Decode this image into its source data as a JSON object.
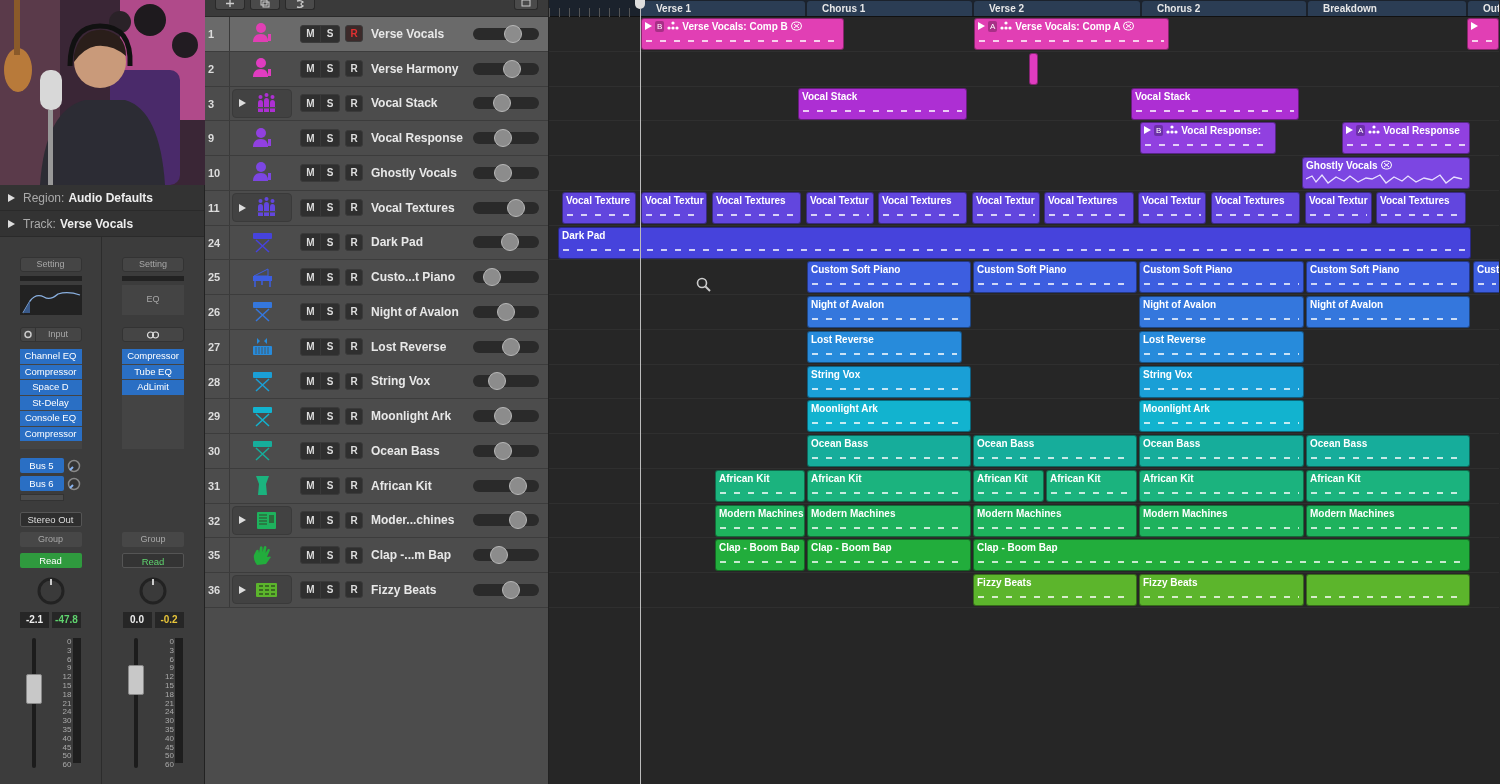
{
  "inspector": {
    "region": {
      "label": "Region:",
      "value": "Audio Defaults"
    },
    "track": {
      "label": "Track:",
      "value": "Verse Vocals"
    }
  },
  "channel_strips": [
    {
      "setting": "Setting",
      "eq": {
        "kind": "curve"
      },
      "input": {
        "kind": "input",
        "label": "Input"
      },
      "plugins": [
        "Channel EQ",
        "Compressor",
        "Space D",
        "St-Delay",
        "Console EQ",
        "Compressor"
      ],
      "sends": [
        "Bus 5",
        "Bus 6"
      ],
      "output": "Stereo Out",
      "group": "Group",
      "automation": {
        "label": "Read",
        "active": true
      },
      "readings": [
        {
          "text": "-2.1",
          "color": "#eeeeee"
        },
        {
          "text": "-47.8",
          "color": "#5fd36e"
        }
      ],
      "level": 0.64,
      "scale": [
        "0",
        "3",
        "6",
        "9",
        "12",
        "15",
        "18",
        "21",
        "24",
        "30",
        "35",
        "40",
        "45",
        "50",
        "60"
      ]
    },
    {
      "setting": "Setting",
      "eq": {
        "kind": "label",
        "label": "EQ"
      },
      "input": {
        "kind": "link"
      },
      "plugins": [
        "Compressor",
        "Tube EQ",
        "AdLimit"
      ],
      "group": "Group",
      "automation": {
        "label": "Read",
        "active": false
      },
      "readings": [
        {
          "text": "0.0",
          "color": "#eeeeee"
        },
        {
          "text": "-0.2",
          "color": "#e8c53a"
        }
      ],
      "level": 0.73,
      "scale": [
        "0",
        "3",
        "6",
        "9",
        "12",
        "15",
        "18",
        "21",
        "24",
        "30",
        "35",
        "40",
        "45",
        "50",
        "60"
      ]
    }
  ],
  "sections": [
    "Verse 1",
    "Chorus 1",
    "Verse 2",
    "Chorus 2",
    "Breakdown",
    "Out"
  ],
  "tracks": [
    {
      "number": "1",
      "name": "Verse Vocals",
      "kind": "vocalist",
      "expandable": false,
      "color": "#e13fb4",
      "selected": true,
      "mute": "M",
      "solo": "S",
      "record": "R",
      "record_armed": true,
      "level": 0.65,
      "regions": [
        {
          "label": "Verse Vocals: Comp B",
          "comp": true,
          "take": "B",
          "flex": true
        },
        {
          "label": "Verse Vocals: Comp A",
          "comp": true,
          "take": "A",
          "flex": true
        },
        {
          "comp": true
        }
      ]
    },
    {
      "number": "2",
      "name": "Verse Harmony",
      "kind": "vocalist",
      "expandable": false,
      "color": "#e03cc0",
      "selected": false,
      "mute": "M",
      "solo": "S",
      "record": "R",
      "record_armed": false,
      "level": 0.63,
      "regions": [
        {
          "comp": false
        }
      ]
    },
    {
      "number": "3",
      "name": "Vocal Stack",
      "kind": "choir",
      "expandable": true,
      "color": "#ad2fd3",
      "selected": false,
      "mute": "M",
      "solo": "S",
      "record": "R",
      "record_armed": false,
      "level": 0.41,
      "regions": [
        {
          "label": "Vocal Stack",
          "comp": false
        },
        {
          "label": "Vocal Stack",
          "comp": false
        }
      ]
    },
    {
      "number": "9",
      "name": "Vocal Response",
      "kind": "vocalist",
      "expandable": false,
      "color": "#9140e0",
      "selected": false,
      "mute": "M",
      "solo": "S",
      "record": "R",
      "record_armed": false,
      "level": 0.43,
      "regions": [
        {
          "label": "Vocal Response:",
          "comp": true,
          "take": "B"
        },
        {
          "label": "Vocal Response",
          "comp": true,
          "take": "A"
        }
      ]
    },
    {
      "number": "10",
      "name": "Ghostly Vocals",
      "kind": "vocalist",
      "expandable": false,
      "color": "#7c46e2",
      "selected": false,
      "mute": "M",
      "solo": "S",
      "record": "R",
      "record_armed": false,
      "level": 0.43,
      "regions": [
        {
          "label": "Ghostly Vocals",
          "comp": false,
          "flex": true,
          "wave": true
        }
      ]
    },
    {
      "number": "11",
      "name": "Vocal Textures",
      "kind": "choir",
      "expandable": true,
      "color": "#6246de",
      "selected": false,
      "mute": "M",
      "solo": "S",
      "record": "R",
      "record_armed": false,
      "level": 0.71,
      "regions": [
        {
          "label": "Vocal Texture",
          "comp": false
        },
        {
          "label": "Vocal Textur",
          "comp": false
        },
        {
          "label": "Vocal Textures",
          "comp": false
        },
        {
          "label": "Vocal Textur",
          "comp": false
        },
        {
          "label": "Vocal Textures",
          "comp": false
        },
        {
          "label": "Vocal Textur",
          "comp": false
        },
        {
          "label": "Vocal Textures",
          "comp": false
        },
        {
          "label": "Vocal Textur",
          "comp": false
        },
        {
          "label": "Vocal Textures",
          "comp": false
        },
        {
          "label": "Vocal Textur",
          "comp": false
        },
        {
          "label": "Vocal Textures",
          "comp": false
        }
      ]
    },
    {
      "number": "24",
      "name": "Dark Pad",
      "kind": "keyboard",
      "expandable": false,
      "color": "#4643dc",
      "selected": false,
      "mute": "M",
      "solo": "S",
      "record": "R",
      "record_armed": false,
      "level": 0.59,
      "regions": [
        {
          "label": "Dark Pad",
          "comp": false
        }
      ]
    },
    {
      "number": "25",
      "name": "Custo...t Piano",
      "kind": "piano",
      "expandable": false,
      "color": "#3d5ee0",
      "selected": false,
      "mute": "M",
      "solo": "S",
      "record": "R",
      "record_armed": false,
      "level": 0.2,
      "regions": [
        {
          "label": "Custom Soft Piano",
          "comp": false
        },
        {
          "label": "Custom Soft Piano",
          "comp": false
        },
        {
          "label": "Custom Soft Piano",
          "comp": false
        },
        {
          "label": "Custom Soft Piano",
          "comp": false
        },
        {
          "label": "Cust",
          "comp": false
        }
      ]
    },
    {
      "number": "26",
      "name": "Night of Avalon",
      "kind": "keyboard",
      "expandable": false,
      "color": "#3477dd",
      "selected": false,
      "mute": "M",
      "solo": "S",
      "record": "R",
      "record_armed": false,
      "level": 0.49,
      "regions": [
        {
          "label": "Night of Avalon",
          "comp": false
        },
        {
          "label": "Night of Avalon",
          "comp": false
        },
        {
          "label": "Night of Avalon",
          "comp": false
        }
      ]
    },
    {
      "number": "27",
      "name": "Lost Reverse",
      "kind": "sampler",
      "expandable": false,
      "color": "#278bdb",
      "selected": false,
      "mute": "M",
      "solo": "S",
      "record": "R",
      "record_armed": false,
      "level": 0.61,
      "regions": [
        {
          "label": "Lost Reverse",
          "comp": false
        },
        {
          "label": "Lost Reverse",
          "comp": false
        }
      ]
    },
    {
      "number": "28",
      "name": "String Vox",
      "kind": "keyboard",
      "expandable": false,
      "color": "#1a9fd6",
      "selected": false,
      "mute": "M",
      "solo": "S",
      "record": "R",
      "record_armed": false,
      "level": 0.31,
      "regions": [
        {
          "label": "String Vox",
          "comp": false
        },
        {
          "label": "String Vox",
          "comp": false
        }
      ]
    },
    {
      "number": "29",
      "name": "Moonlight Ark",
      "kind": "keyboard",
      "expandable": false,
      "color": "#12b3cf",
      "selected": false,
      "mute": "M",
      "solo": "S",
      "record": "R",
      "record_armed": false,
      "level": 0.43,
      "regions": [
        {
          "label": "Moonlight Ark",
          "comp": false
        },
        {
          "label": "Moonlight Ark",
          "comp": false
        }
      ]
    },
    {
      "number": "30",
      "name": "Ocean Bass",
      "kind": "keyboard",
      "expandable": false,
      "color": "#16ad9b",
      "selected": false,
      "mute": "M",
      "solo": "S",
      "record": "R",
      "record_armed": false,
      "level": 0.43,
      "regions": [
        {
          "label": "Ocean Bass",
          "comp": false
        },
        {
          "label": "Ocean Bass",
          "comp": false
        },
        {
          "label": "Ocean Bass",
          "comp": false
        },
        {
          "label": "Ocean Bass",
          "comp": false
        }
      ]
    },
    {
      "number": "31",
      "name": "African Kit",
      "kind": "djembe",
      "expandable": false,
      "color": "#1bb37e",
      "selected": false,
      "mute": "M",
      "solo": "S",
      "record": "R",
      "record_armed": false,
      "level": 0.75,
      "regions": [
        {
          "label": "African Kit",
          "comp": false
        },
        {
          "label": "African Kit",
          "comp": false
        },
        {
          "label": "African Kit",
          "comp": false
        },
        {
          "label": "African Kit",
          "comp": false
        },
        {
          "label": "African Kit",
          "comp": false
        },
        {
          "label": "African Kit",
          "comp": false
        }
      ]
    },
    {
      "number": "32",
      "name": "Moder...chines",
      "kind": "drum_machine",
      "expandable": true,
      "color": "#1eb25d",
      "selected": false,
      "mute": "M",
      "solo": "S",
      "record": "R",
      "record_armed": false,
      "level": 0.75,
      "regions": [
        {
          "label": "Modern Machines",
          "comp": false
        },
        {
          "label": "Modern Machines",
          "comp": false
        },
        {
          "label": "Modern Machines",
          "comp": false
        },
        {
          "label": "Modern Machines",
          "comp": false
        },
        {
          "label": "Modern Machines",
          "comp": false
        }
      ]
    },
    {
      "number": "35",
      "name": "Clap -...m Bap",
      "kind": "hand",
      "expandable": false,
      "color": "#22ad3c",
      "selected": false,
      "mute": "M",
      "solo": "S",
      "record": "R",
      "record_armed": false,
      "level": 0.35,
      "regions": [
        {
          "label": "Clap - Boom Bap",
          "comp": false
        },
        {
          "label": "Clap - Boom Bap",
          "comp": false
        },
        {
          "label": "Clap - Boom Bap",
          "comp": false
        }
      ]
    },
    {
      "number": "36",
      "name": "Fizzy Beats",
      "kind": "beat_pad",
      "expandable": true,
      "color": "#5cb52c",
      "selected": false,
      "mute": "M",
      "solo": "S",
      "record": "R",
      "record_armed": false,
      "level": 0.61,
      "regions": [
        {
          "label": "Fizzy Beats",
          "comp": false
        },
        {
          "label": "Fizzy Beats",
          "comp": false
        },
        {
          "comp": false
        }
      ]
    }
  ]
}
